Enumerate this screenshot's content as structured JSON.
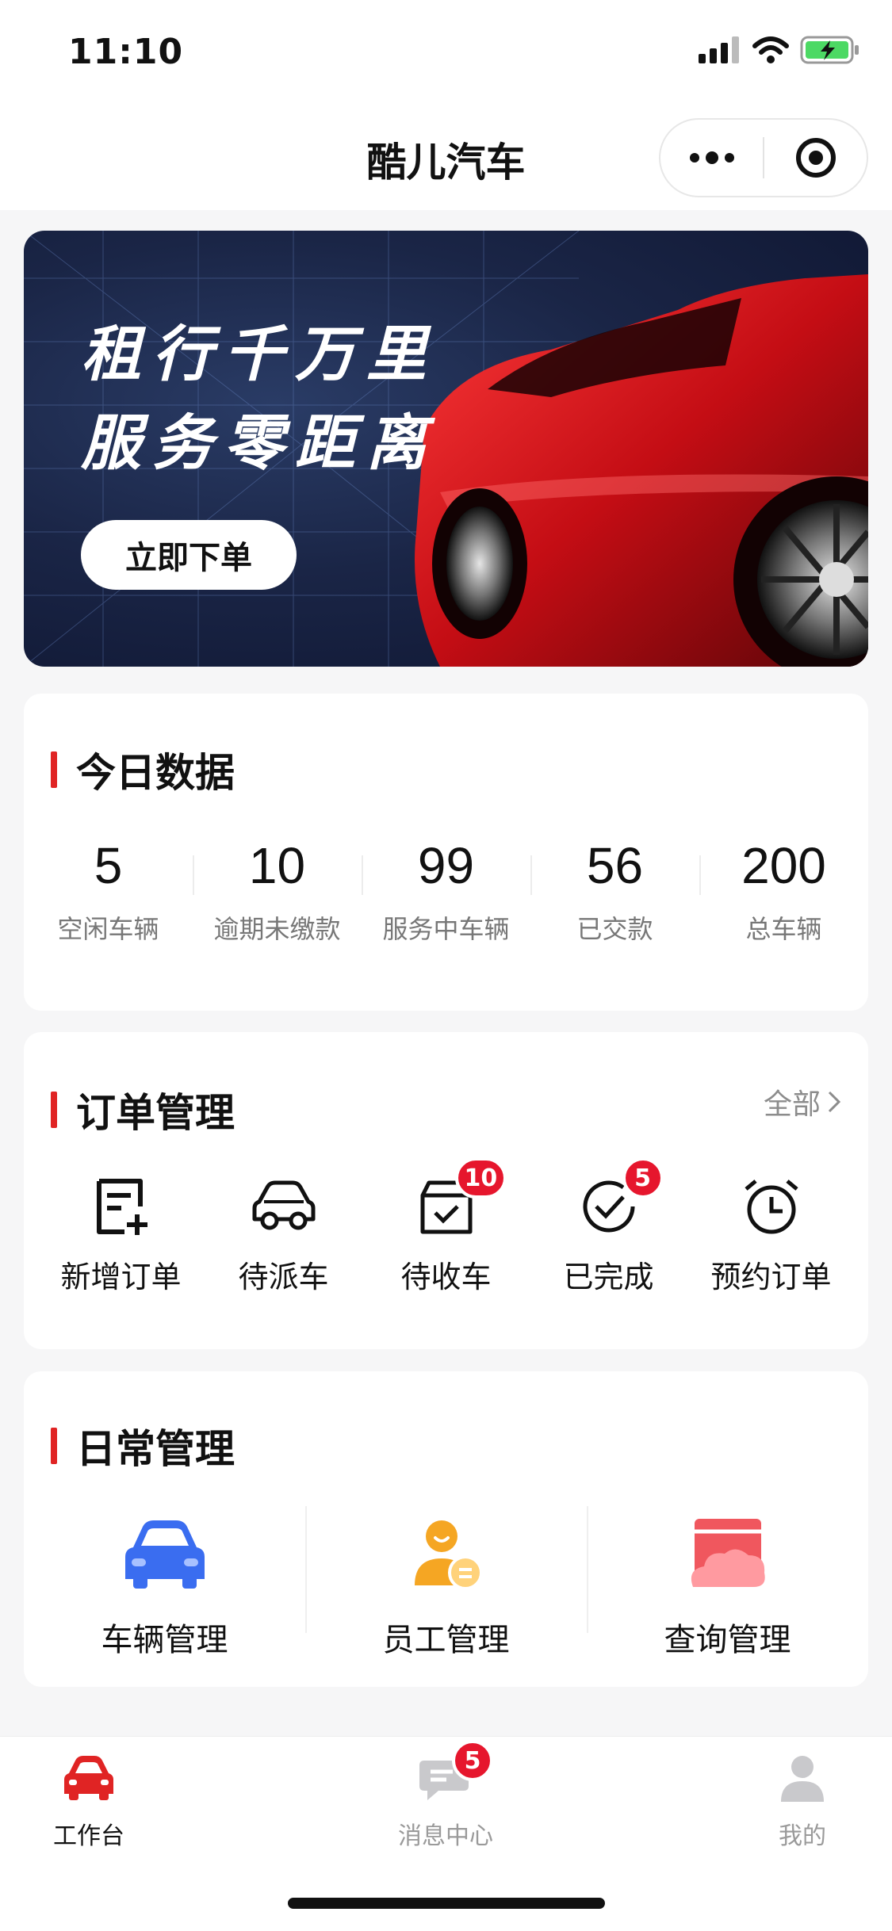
{
  "status": {
    "time": "11:10"
  },
  "nav": {
    "title": "酷儿汽车"
  },
  "banner": {
    "line1": "租行千万里",
    "line2": "服务零距离",
    "button": "立即下单"
  },
  "today": {
    "title": "今日数据",
    "stats": [
      {
        "value": "5",
        "label": "空闲车辆"
      },
      {
        "value": "10",
        "label": "逾期未缴款"
      },
      {
        "value": "99",
        "label": "服务中车辆"
      },
      {
        "value": "56",
        "label": "已交款"
      },
      {
        "value": "200",
        "label": "总车辆"
      }
    ]
  },
  "orders": {
    "title": "订单管理",
    "more": "全部",
    "items": [
      {
        "label": "新增订单",
        "icon": "add-order-icon"
      },
      {
        "label": "待派车",
        "icon": "car-outline-icon"
      },
      {
        "label": "待收车",
        "icon": "box-check-icon",
        "badge": "10"
      },
      {
        "label": "已完成",
        "icon": "check-circle-icon",
        "badge": "5"
      },
      {
        "label": "预约订单",
        "icon": "alarm-clock-icon"
      }
    ]
  },
  "daily": {
    "title": "日常管理",
    "items": [
      {
        "label": "车辆管理",
        "icon": "vehicle-icon"
      },
      {
        "label": "员工管理",
        "icon": "staff-icon"
      },
      {
        "label": "查询管理",
        "icon": "query-icon"
      }
    ]
  },
  "tabbar": {
    "items": [
      {
        "label": "工作台",
        "active": true
      },
      {
        "label": "消息中心",
        "badge": "5"
      },
      {
        "label": "我的"
      }
    ]
  },
  "colors": {
    "accent": "#e02424",
    "badge": "#e6162d",
    "vehicle": "#3a6df0",
    "staff": "#f5a623",
    "query": "#f0575e"
  }
}
